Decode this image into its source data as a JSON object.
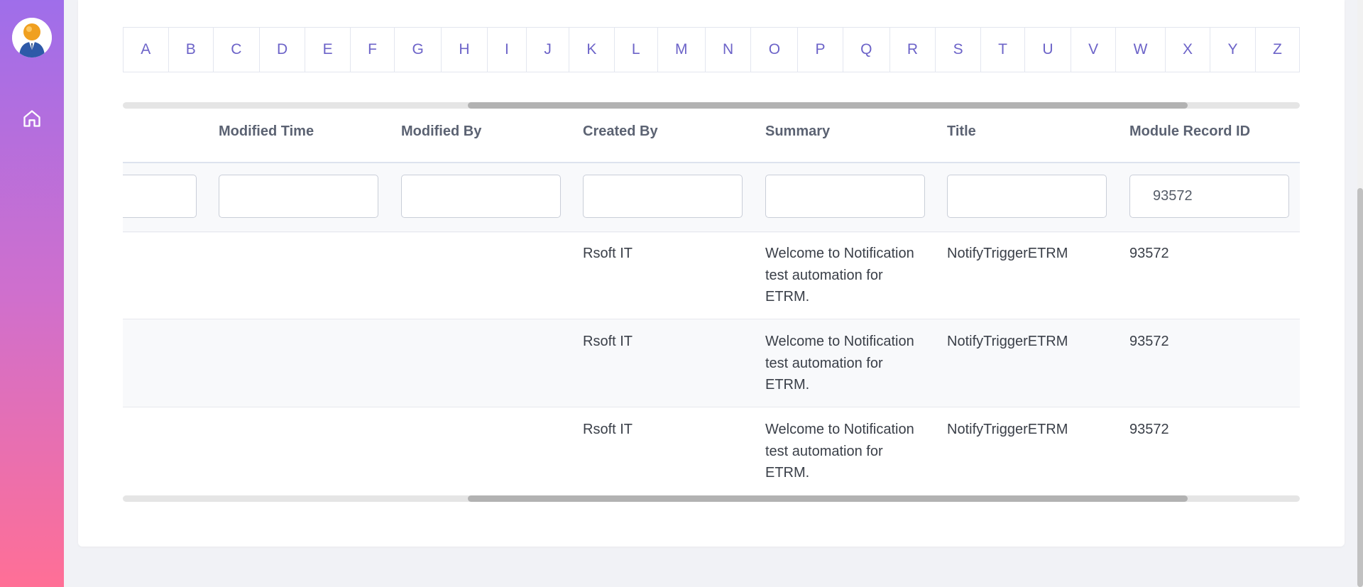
{
  "sidebar": {
    "avatar_icon": "user-avatar-icon",
    "home_icon": "home-icon"
  },
  "alphabet": [
    "A",
    "B",
    "C",
    "D",
    "E",
    "F",
    "G",
    "H",
    "I",
    "J",
    "K",
    "L",
    "M",
    "N",
    "O",
    "P",
    "Q",
    "R",
    "S",
    "T",
    "U",
    "V",
    "W",
    "X",
    "Y",
    "Z"
  ],
  "table": {
    "columns": [
      "Modified Time",
      "Modified By",
      "Created By",
      "Summary",
      "Title",
      "Module Record ID"
    ],
    "filters": [
      "",
      "",
      "",
      "",
      "",
      "",
      "93572"
    ],
    "rows": [
      {
        "created_by": "Rsoft IT",
        "summary": "Welcome to Notification test automation for ETRM.",
        "title": "NotifyTriggerETRM",
        "module_record_id": "93572"
      },
      {
        "created_by": "Rsoft IT",
        "summary": "Welcome to Notification test automation for ETRM.",
        "title": "NotifyTriggerETRM",
        "module_record_id": "93572"
      },
      {
        "created_by": "Rsoft IT",
        "summary": "Welcome to Notification test automation for ETRM.",
        "title": "NotifyTriggerETRM",
        "module_record_id": "93572"
      }
    ]
  },
  "colors": {
    "sidebar_top": "#9f6eea",
    "sidebar_bottom": "#ff6f96",
    "letter": "#6c63c8"
  }
}
